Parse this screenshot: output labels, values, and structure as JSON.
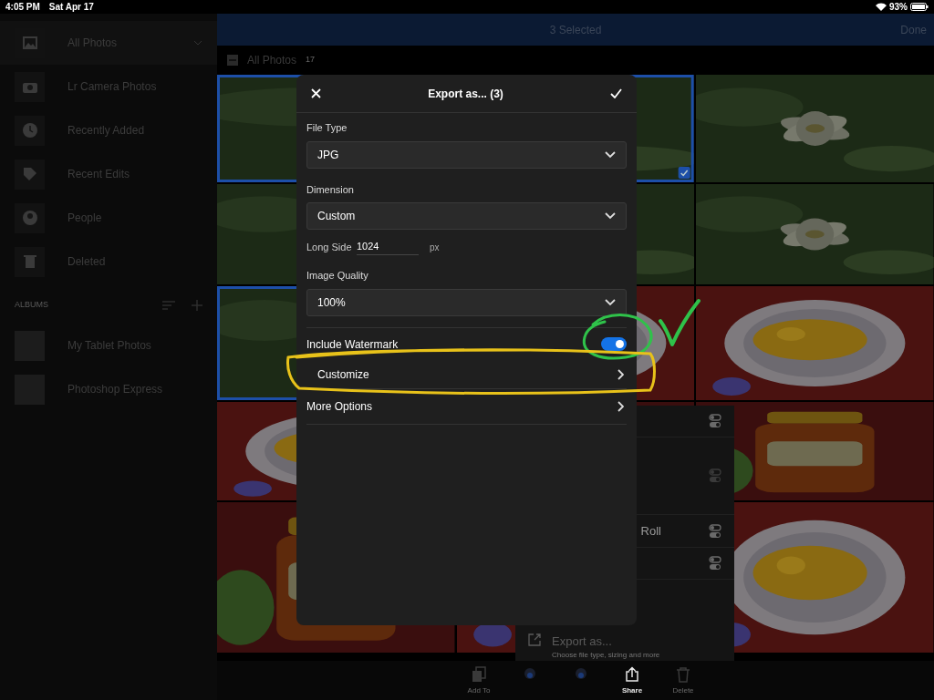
{
  "status_bar": {
    "time": "4:05 PM",
    "date": "Sat Apr 17",
    "battery": "93%"
  },
  "sidebar": {
    "items": [
      {
        "label": "All Photos",
        "selected": true
      },
      {
        "label": "Lr Camera Photos",
        "selected": false
      },
      {
        "label": "Recently Added",
        "selected": false
      },
      {
        "label": "Recent Edits",
        "selected": false
      },
      {
        "label": "People",
        "selected": false
      },
      {
        "label": "Deleted",
        "selected": false
      }
    ],
    "albums_header": "ALBUMS",
    "albums": [
      "My Tablet Photos",
      "Photoshop Express"
    ]
  },
  "header": {
    "title": "3 Selected",
    "done": "Done"
  },
  "section": {
    "title": "All Photos",
    "count": "17",
    "partly_selected": true
  },
  "photos": [
    [
      {
        "kind": "flower",
        "selected": true
      },
      {
        "kind": "flower",
        "selected": false
      }
    ],
    [
      {
        "kind": "flower",
        "selected": false
      },
      {
        "kind": "flower",
        "selected": false
      },
      {
        "kind": "flower",
        "selected": false
      }
    ],
    [
      {
        "kind": "flower",
        "selected": true
      },
      {
        "kind": "food",
        "selected": false
      },
      {
        "kind": "food",
        "selected": false
      }
    ],
    [
      {
        "kind": "food",
        "selected": false
      },
      {
        "kind": "jar",
        "selected": false
      },
      {
        "kind": "jar",
        "selected": false
      }
    ],
    [
      {
        "kind": "jar",
        "selected": false
      },
      {
        "kind": "food",
        "selected": false
      },
      {
        "kind": "food",
        "selected": false
      }
    ]
  ],
  "share_sheet": {
    "rows": [
      {
        "kind": "option"
      },
      {
        "kind": "option"
      },
      {
        "kind": "option",
        "label": "Roll"
      },
      {
        "kind": "option"
      }
    ],
    "export_title": "Export as...",
    "export_subtitle": "Choose file type, sizing and more"
  },
  "toolbar": [
    {
      "label": "Add To",
      "selected": false
    },
    {
      "selected": false
    },
    {
      "selected": false
    },
    {
      "label": "Share",
      "selected": true
    },
    {
      "label": "Delete",
      "selected": false
    }
  ],
  "dialog": {
    "title": "Export as... (3)",
    "file_type_label": "File Type",
    "file_type": "JPG",
    "dimension_label": "Dimension",
    "dimension": "Custom",
    "long_side_label": "Long Side",
    "long_side": "1024",
    "long_side_unit": "px",
    "quality_label": "Image Quality",
    "quality": "100%",
    "watermark_label": "Include Watermark",
    "watermark_on": true,
    "customize": "Customize",
    "more_options": "More Options"
  }
}
